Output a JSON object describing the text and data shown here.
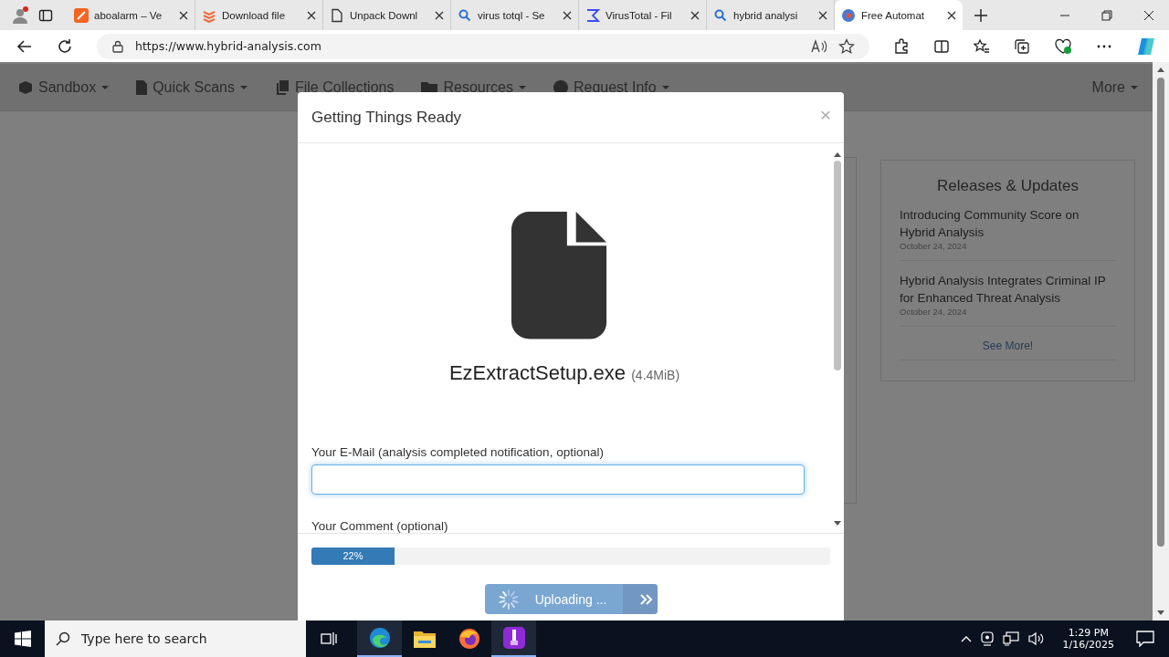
{
  "browser": {
    "tabs": [
      {
        "title": "aboalarm – Ve",
        "kind": "orange",
        "selected": false
      },
      {
        "title": "Download file",
        "kind": "stack",
        "selected": false
      },
      {
        "title": "Unpack Downl",
        "kind": "page",
        "selected": false
      },
      {
        "title": "virus totql - Se",
        "kind": "search",
        "selected": false
      },
      {
        "title": "VirusTotal - Fil",
        "kind": "sigma",
        "selected": false
      },
      {
        "title": "hybrid analysi",
        "kind": "search",
        "selected": false
      },
      {
        "title": "Free Automat",
        "kind": "globe",
        "selected": true
      }
    ],
    "url": "https://www.hybrid-analysis.com"
  },
  "nav": {
    "items": [
      {
        "label": "Sandbox",
        "kind": "cube",
        "dropdown": true
      },
      {
        "label": "Quick Scans",
        "kind": "file",
        "dropdown": true
      },
      {
        "label": "File Collections",
        "kind": "files",
        "dropdown": false
      },
      {
        "label": "Resources",
        "kind": "folder",
        "dropdown": true
      },
      {
        "label": "Request Info",
        "kind": "question",
        "dropdown": true
      }
    ],
    "more": {
      "label": "More",
      "dropdown": true
    }
  },
  "releases": {
    "title": "Releases & Updates",
    "items": [
      {
        "title": "Introducing Community Score on Hybrid Analysis",
        "date": "October 24, 2024"
      },
      {
        "title": "Hybrid Analysis Integrates Criminal IP for Enhanced Threat Analysis",
        "date": "October 24, 2024"
      }
    ],
    "link": "See More!"
  },
  "modal": {
    "title": "Getting Things Ready",
    "close": "×",
    "file_name": "EzExtractSetup.exe",
    "file_size": "(4.4MiB)",
    "email_label": "Your E-Mail (analysis completed notification, optional)",
    "comment_label": "Your Comment (optional)",
    "progress": {
      "level": 0.16,
      "label": "22%"
    },
    "button": "Uploading ..."
  },
  "taskbar": {
    "search_placeholder": "Type here to search",
    "apps": [
      {
        "kind": "edge",
        "active": true
      },
      {
        "kind": "explorer",
        "active": false
      },
      {
        "kind": "firefox",
        "active": false
      },
      {
        "kind": "archive",
        "active": true
      }
    ],
    "time": "1:29 PM",
    "date": "1/16/2025"
  }
}
